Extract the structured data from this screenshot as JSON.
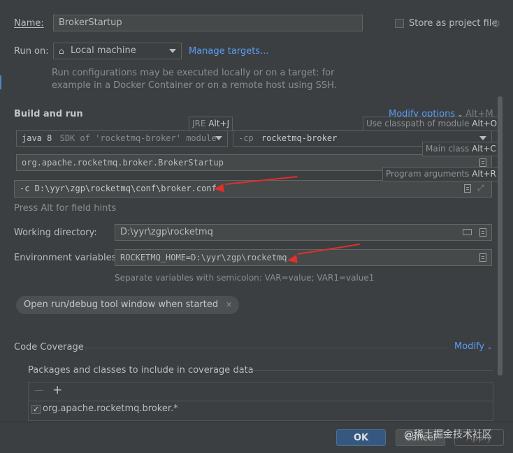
{
  "name": {
    "label": "Name:",
    "value": "BrokerStartup"
  },
  "store_project_file": {
    "label": "Store as project file",
    "checked": false
  },
  "run_on": {
    "label": "Run on:",
    "target": "Local machine",
    "manage_link": "Manage targets...",
    "description_line1": "Run configurations may be executed locally or on a target: for",
    "description_line2": "example in a Docker Container or on a remote host using SSH."
  },
  "build_and_run": {
    "title": "Build and run",
    "modify_options": "Modify options",
    "modify_options_shortcut": "Alt+M",
    "jre_hint": {
      "text": "JRE ",
      "shortcut": "Alt+J"
    },
    "classpath_hint": {
      "text": "Use classpath of module ",
      "shortcut": "Alt+O"
    },
    "main_class_hint": {
      "text": "Main class ",
      "shortcut": "Alt+C"
    },
    "program_args_hint": {
      "text": "Program arguments ",
      "shortcut": "Alt+R"
    },
    "jdk_value": "java 8",
    "jdk_suffix": "SDK of 'rocketmq-broker' module",
    "cp_flag": "-cp",
    "cp_module": "rocketmq-broker",
    "main_class": "org.apache.rocketmq.broker.BrokerStartup",
    "program_args": "-c D:\\yyr\\zgp\\rocketmq\\conf\\broker.conf",
    "field_hints_note": "Press Alt for field hints"
  },
  "working_directory": {
    "label": "Working directory:",
    "value": "D:\\yyr\\zgp\\rocketmq"
  },
  "environment_variables": {
    "label": "Environment variables:",
    "value": "ROCKETMQ_HOME=D:\\yyr\\zgp\\rocketmq",
    "note": "Separate variables with semicolon: VAR=value; VAR1=value1"
  },
  "open_tool_window_tag": "Open run/debug tool window when started",
  "code_coverage": {
    "title": "Code Coverage",
    "modify": "Modify",
    "packages_label": "Packages and classes to include in coverage data",
    "remove_icon": "—",
    "add_icon": "+",
    "entries": [
      {
        "text": "org.apache.rocketmq.broker.*",
        "checked": true
      }
    ]
  },
  "buttons": {
    "ok": "OK",
    "cancel": "Cancel",
    "apply": "Apply"
  },
  "watermark": "@稀土掘金技术社区",
  "colors": {
    "background": "#3c3f41",
    "field": "#45494a",
    "link": "#589df6",
    "ok_button": "#365880",
    "arrow": "#e0302a"
  }
}
